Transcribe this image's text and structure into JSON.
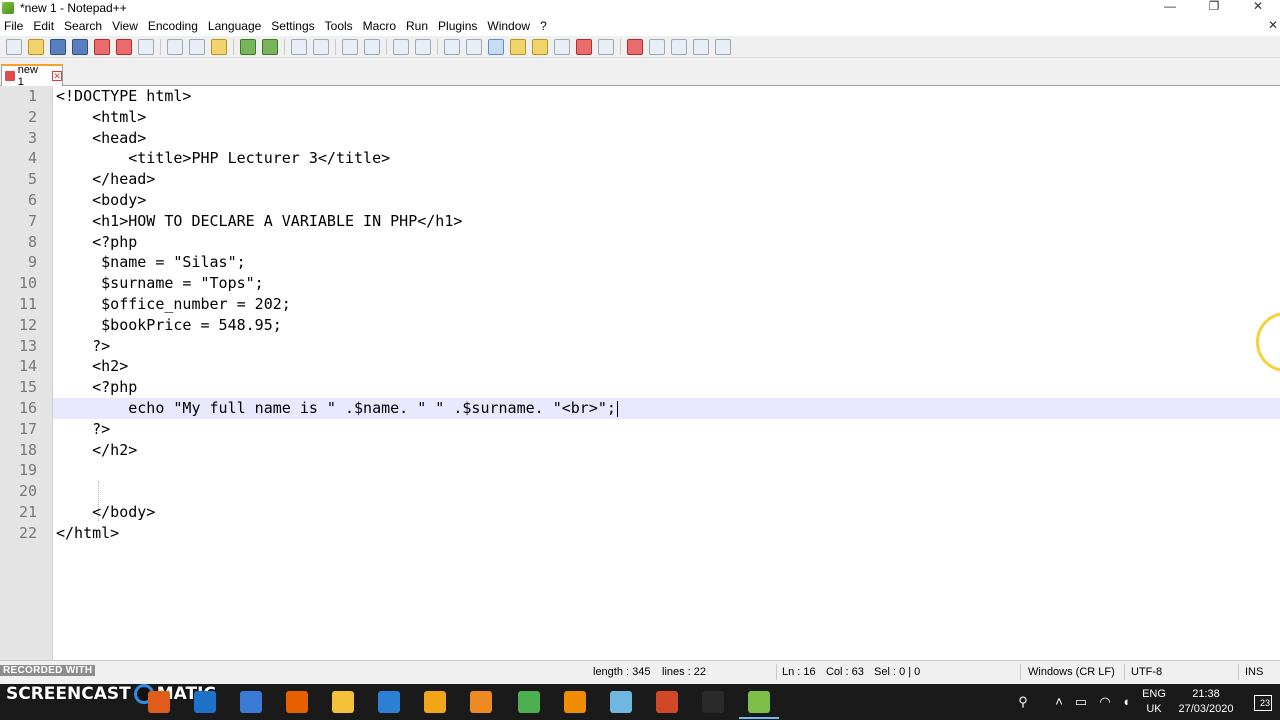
{
  "window": {
    "title": "*new 1 - Notepad++",
    "minimize": "—",
    "restore": "❐",
    "close": "✕"
  },
  "menu": {
    "items": [
      "File",
      "Edit",
      "Search",
      "View",
      "Encoding",
      "Language",
      "Settings",
      "Tools",
      "Macro",
      "Run",
      "Plugins",
      "Window",
      "?"
    ],
    "doc_close": "✕"
  },
  "tab": {
    "label": "new 1",
    "close": "✕"
  },
  "editor": {
    "current_line": 16,
    "lines": [
      {
        "n": "1",
        "text": "<!DOCTYPE html>"
      },
      {
        "n": "2",
        "text": "    <html>"
      },
      {
        "n": "3",
        "text": "    <head>"
      },
      {
        "n": "4",
        "text": "        <title>PHP Lecturer 3</title>"
      },
      {
        "n": "5",
        "text": "    </head>"
      },
      {
        "n": "6",
        "text": "    <body>"
      },
      {
        "n": "7",
        "text": "    <h1>HOW TO DECLARE A VARIABLE IN PHP</h1>"
      },
      {
        "n": "8",
        "text": "    <?php"
      },
      {
        "n": "9",
        "text": "     $name = \"Silas\";"
      },
      {
        "n": "10",
        "text": "     $surname = \"Tops\";"
      },
      {
        "n": "11",
        "text": "     $office_number = 202;"
      },
      {
        "n": "12",
        "text": "     $bookPrice = 548.95;"
      },
      {
        "n": "13",
        "text": "    ?>"
      },
      {
        "n": "14",
        "text": "    <h2>"
      },
      {
        "n": "15",
        "text": "    <?php"
      },
      {
        "n": "16",
        "text": "        echo \"My full name is \" .$name. \" \" .$surname. \"<br>\";"
      },
      {
        "n": "17",
        "text": "    ?>"
      },
      {
        "n": "18",
        "text": "    </h2>"
      },
      {
        "n": "19",
        "text": ""
      },
      {
        "n": "20",
        "text": ""
      },
      {
        "n": "21",
        "text": "    </body>"
      },
      {
        "n": "22",
        "text": "</html>"
      }
    ]
  },
  "status": {
    "length": "length : 345",
    "lines": "lines : 22",
    "ln": "Ln : 16",
    "col": "Col : 63",
    "sel": "Sel : 0 | 0",
    "eol": "Windows (CR LF)",
    "encoding": "UTF-8",
    "mode": "INS"
  },
  "overlay": {
    "recorded_with": "RECORDED WITH",
    "watermark_left": "SCREENCAST",
    "watermark_right": "MATIC"
  },
  "taskbar": {
    "lang_top": "ENG",
    "lang_bottom": "UK",
    "time": "21:38",
    "date": "27/03/2020",
    "notifications": "23",
    "apps": [
      {
        "name": "search-icon",
        "color": "#1a1a1a"
      },
      {
        "name": "task-view-icon",
        "color": "#1a1a1a"
      },
      {
        "name": "app-orange-icon",
        "color": "#e05c1a"
      },
      {
        "name": "edge-icon",
        "color": "#1e73c9"
      },
      {
        "name": "store-icon",
        "color": "#3a7bd5"
      },
      {
        "name": "firefox-icon",
        "color": "#e66000"
      },
      {
        "name": "file-explorer-icon",
        "color": "#f3c13a"
      },
      {
        "name": "mail-icon",
        "color": "#2d7fd3"
      },
      {
        "name": "laptop-app-icon",
        "color": "#f2a516"
      },
      {
        "name": "sublime-icon",
        "color": "#ef8a23"
      },
      {
        "name": "chrome-icon",
        "color": "#4caf50"
      },
      {
        "name": "vlc-icon",
        "color": "#f08c00"
      },
      {
        "name": "notepad-icon",
        "color": "#6fb7e0"
      },
      {
        "name": "powerpoint-icon",
        "color": "#d24726"
      },
      {
        "name": "screencast-icon",
        "color": "#2a2a2a"
      },
      {
        "name": "notepadpp-icon",
        "color": "#7cc04a"
      }
    ]
  }
}
